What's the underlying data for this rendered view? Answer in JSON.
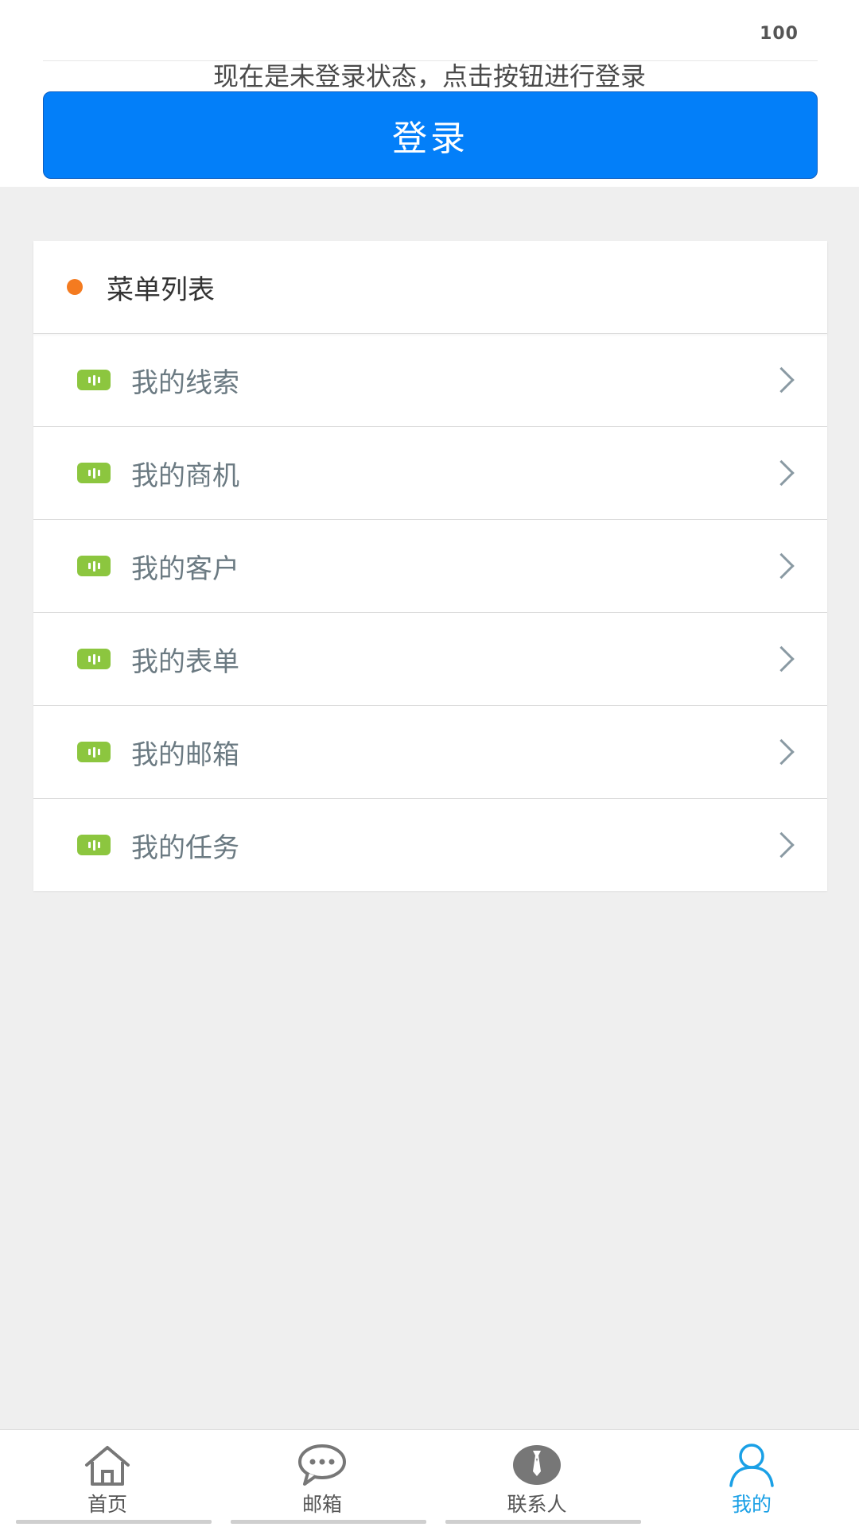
{
  "status": {
    "value": "100"
  },
  "login": {
    "hint": "现在是未登录状态，点击按钮进行登录",
    "button_label": "登录",
    "button_color": "#037ff9"
  },
  "menu": {
    "title": "菜单列表",
    "dot_color": "#f47b20",
    "icon_color": "#8cc63f",
    "items": [
      {
        "label": "我的线索",
        "icon": "list-icon"
      },
      {
        "label": "我的商机",
        "icon": "list-icon"
      },
      {
        "label": "我的客户",
        "icon": "list-icon"
      },
      {
        "label": "我的表单",
        "icon": "list-icon"
      },
      {
        "label": "我的邮箱",
        "icon": "list-icon"
      },
      {
        "label": "我的任务",
        "icon": "list-icon"
      }
    ]
  },
  "tabbar": {
    "active_color": "#1aa0e6",
    "tabs": [
      {
        "label": "首页",
        "icon": "home-icon",
        "active": false
      },
      {
        "label": "邮箱",
        "icon": "chat-bubble-icon",
        "active": false
      },
      {
        "label": "联系人",
        "icon": "contact-tie-icon",
        "active": false
      },
      {
        "label": "我的",
        "icon": "user-icon",
        "active": true
      }
    ]
  }
}
